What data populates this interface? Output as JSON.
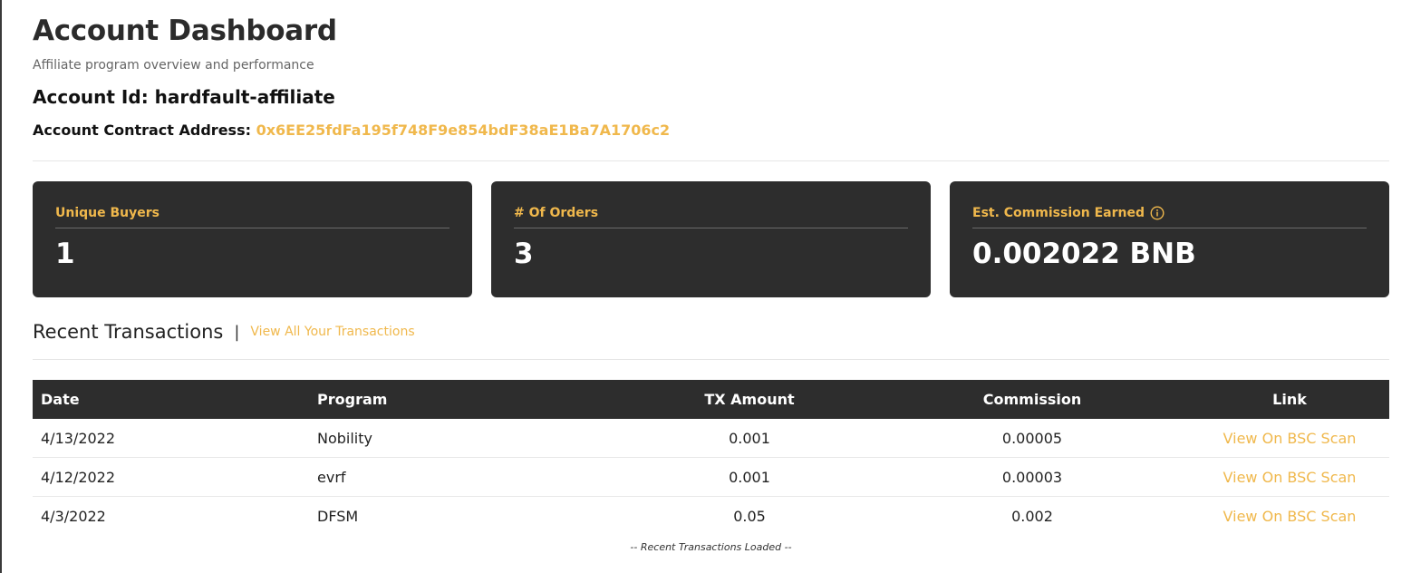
{
  "header": {
    "title": "Account Dashboard",
    "subtitle": "Affiliate program overview and performance",
    "account_id_label": "Account Id:",
    "account_id_value": "hardfault-affiliate",
    "contract_label": "Account Contract Address:",
    "contract_address": "0x6EE25fdFa195f748F9e854bdF38aE1Ba7A1706c2"
  },
  "stats": [
    {
      "label": "Unique Buyers",
      "value": "1"
    },
    {
      "label": "# Of Orders",
      "value": "3"
    },
    {
      "label": "Est. Commission Earned",
      "value": "0.002022 BNB",
      "icon": "info-icon"
    }
  ],
  "transactions": {
    "title": "Recent Transactions",
    "separator": "|",
    "view_all_label": "View All Your Transactions",
    "columns": [
      "Date",
      "Program",
      "TX Amount",
      "Commission",
      "Link"
    ],
    "rows": [
      {
        "date": "4/13/2022",
        "program": "Nobility",
        "amount": "0.001",
        "commission": "0.00005",
        "link": "View On BSC Scan"
      },
      {
        "date": "4/12/2022",
        "program": "evrf",
        "amount": "0.001",
        "commission": "0.00003",
        "link": "View On BSC Scan"
      },
      {
        "date": "4/3/2022",
        "program": "DFSM",
        "amount": "0.05",
        "commission": "0.002",
        "link": "View On BSC Scan"
      }
    ],
    "footer_note": "-- Recent Transactions Loaded --"
  },
  "colors": {
    "accent": "#f0b84c",
    "card_bg": "#2d2d2d",
    "table_header_bg": "#2d2d2d"
  }
}
